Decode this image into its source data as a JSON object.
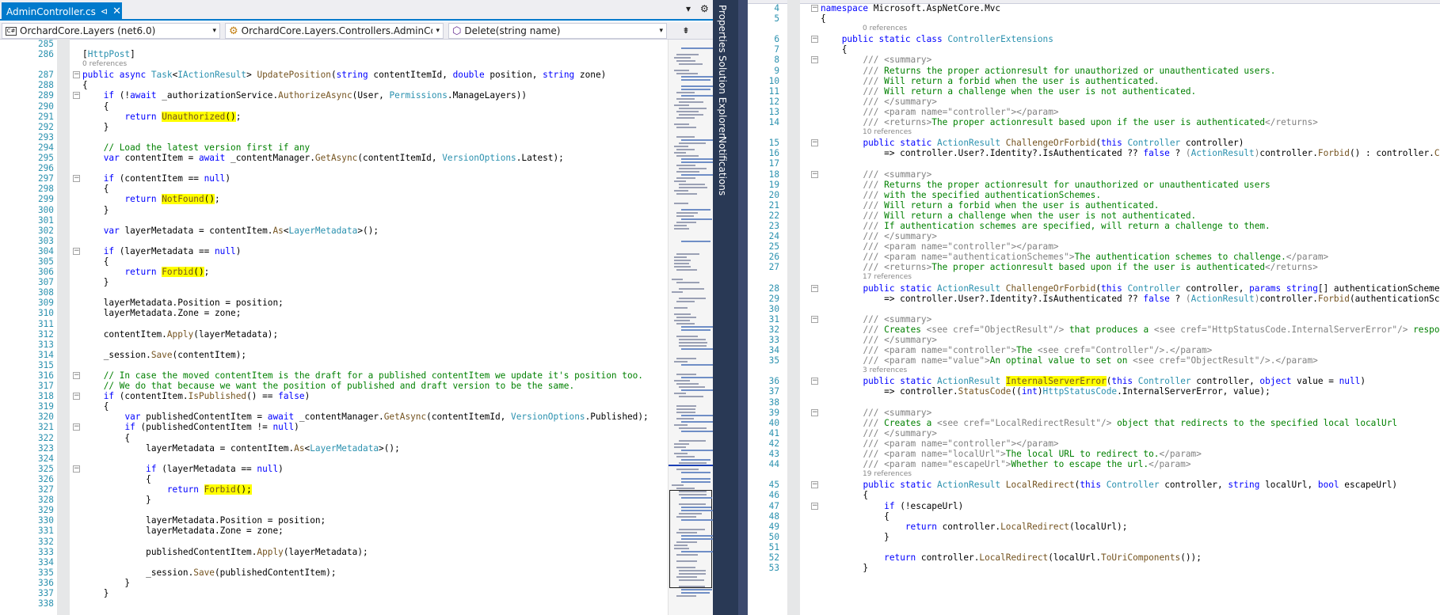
{
  "tab": {
    "title": "AdminController.cs",
    "pin": "⊲",
    "close": "✕"
  },
  "strip": {
    "dropdown": "▾",
    "settings": "⚙"
  },
  "nav": {
    "project": "OrchardCore.Layers (net6.0)",
    "project_glyph": "C#",
    "class": "OrchardCore.Layers.Controllers.AdminContro",
    "method": "Delete(string name)",
    "arrow": "▾",
    "split": "⇟"
  },
  "toolwindows": [
    "Properties",
    "Solution Explorer",
    "Notifications"
  ],
  "left_lines": [
    {
      "n": "285",
      "h": ""
    },
    {
      "n": "286",
      "h": "[<span class='t'>HttpPost</span>]"
    },
    {
      "ref": "0 references"
    },
    {
      "n": "287",
      "f": "−",
      "h": "<span class='k'>public async</span> <span class='t'>Task</span>&lt;<span class='t'>IActionResult</span>&gt; <span class='m'>UpdatePosition</span>(<span class='k'>string</span> contentItemId, <span class='k'>double</span> position, <span class='k'>string</span> zone)"
    },
    {
      "n": "288",
      "h": "{"
    },
    {
      "n": "289",
      "f": "−",
      "h": "    <span class='k'>if</span> (!<span class='k'>await</span> _authorizationService.<span class='m'>AuthorizeAsync</span>(User, <span class='t'>Permissions</span>.ManageLayers))"
    },
    {
      "n": "290",
      "h": "    {"
    },
    {
      "n": "291",
      "h": "        <span class='k'>return</span> <span class='hl'><span class='m'>Unauthorized</span>()</span>;"
    },
    {
      "n": "292",
      "h": "    }"
    },
    {
      "n": "293",
      "h": ""
    },
    {
      "n": "294",
      "h": "    <span class='c'>// Load the latest version first if any</span>"
    },
    {
      "n": "295",
      "h": "    <span class='k'>var</span> contentItem = <span class='k'>await</span> _contentManager.<span class='m'>GetAsync</span>(contentItemId, <span class='t'>VersionOptions</span>.Latest);"
    },
    {
      "n": "296",
      "h": ""
    },
    {
      "n": "297",
      "f": "−",
      "h": "    <span class='k'>if</span> (contentItem == <span class='k'>null</span>)"
    },
    {
      "n": "298",
      "h": "    {"
    },
    {
      "n": "299",
      "h": "        <span class='k'>return</span> <span class='hl'><span class='m'>NotFound</span>()</span>;"
    },
    {
      "n": "300",
      "h": "    }"
    },
    {
      "n": "301",
      "h": ""
    },
    {
      "n": "302",
      "h": "    <span class='k'>var</span> layerMetadata = contentItem.<span class='m'>As</span>&lt;<span class='t'>LayerMetadata</span>&gt;();"
    },
    {
      "n": "303",
      "h": ""
    },
    {
      "n": "304",
      "f": "−",
      "h": "    <span class='k'>if</span> (layerMetadata == <span class='k'>null</span>)"
    },
    {
      "n": "305",
      "h": "    {"
    },
    {
      "n": "306",
      "h": "        <span class='k'>return</span> <span class='hl'><span class='m'>Forbid</span>()</span>;"
    },
    {
      "n": "307",
      "h": "    }"
    },
    {
      "n": "308",
      "h": ""
    },
    {
      "n": "309",
      "h": "    layerMetadata.Position = position;"
    },
    {
      "n": "310",
      "h": "    layerMetadata.Zone = zone;"
    },
    {
      "n": "311",
      "h": ""
    },
    {
      "n": "312",
      "h": "    contentItem.<span class='m'>Apply</span>(layerMetadata);"
    },
    {
      "n": "313",
      "h": ""
    },
    {
      "n": "314",
      "h": "    _session.<span class='m'>Save</span>(contentItem);"
    },
    {
      "n": "315",
      "h": ""
    },
    {
      "n": "316",
      "f": "−",
      "h": "    <span class='c'>// In case the moved contentItem is the draft for a published contentItem we update it's position too.</span>"
    },
    {
      "n": "317",
      "h": "    <span class='c'>// We do that because we want the position of published and draft version to be the same.</span>"
    },
    {
      "n": "318",
      "f": "−",
      "h": "    <span class='k'>if</span> (contentItem.<span class='m'>IsPublished</span>() == <span class='k'>false</span>)"
    },
    {
      "n": "319",
      "h": "    {"
    },
    {
      "n": "320",
      "h": "        <span class='k'>var</span> publishedContentItem = <span class='k'>await</span> _contentManager.<span class='m'>GetAsync</span>(contentItemId, <span class='t'>VersionOptions</span>.Published);"
    },
    {
      "n": "321",
      "f": "−",
      "h": "        <span class='k'>if</span> (publishedContentItem != <span class='k'>null</span>)"
    },
    {
      "n": "322",
      "h": "        {"
    },
    {
      "n": "323",
      "h": "            layerMetadata = contentItem.<span class='m'>As</span>&lt;<span class='t'>LayerMetadata</span>&gt;();"
    },
    {
      "n": "324",
      "h": ""
    },
    {
      "n": "325",
      "f": "−",
      "h": "            <span class='k'>if</span> (layerMetadata == <span class='k'>null</span>)"
    },
    {
      "n": "326",
      "h": "            {"
    },
    {
      "n": "327",
      "h": "                <span class='k'>return</span> <span class='hl'><span class='m'>Forbid</span>();</span>"
    },
    {
      "n": "328",
      "h": "            }"
    },
    {
      "n": "329",
      "h": ""
    },
    {
      "n": "330",
      "h": "            layerMetadata.Position = position;"
    },
    {
      "n": "331",
      "h": "            layerMetadata.Zone = zone;"
    },
    {
      "n": "332",
      "h": ""
    },
    {
      "n": "333",
      "h": "            publishedContentItem.<span class='m'>Apply</span>(layerMetadata);"
    },
    {
      "n": "334",
      "h": ""
    },
    {
      "n": "335",
      "h": "            _session.<span class='m'>Save</span>(publishedContentItem);"
    },
    {
      "n": "336",
      "h": "        }"
    },
    {
      "n": "337",
      "h": "    }"
    },
    {
      "n": "338",
      "h": ""
    }
  ],
  "right_lines": [
    {
      "n": "4",
      "f": "−",
      "h": "<span class='k'>namespace</span> Microsoft.AspNetCore.Mvc"
    },
    {
      "n": "5",
      "h": "{"
    },
    {
      "ref": "0 references"
    },
    {
      "n": "6",
      "f": "−",
      "h": "    <span class='k'>public static class</span> <span class='t'>ControllerExtensions</span>"
    },
    {
      "n": "7",
      "h": "    {"
    },
    {
      "n": "8",
      "f": "−",
      "h": "        <span class='d'>/// &lt;summary&gt;</span>"
    },
    {
      "n": "9",
      "h": "        <span class='d'>///</span> <span class='c'>Returns the proper actionresult for unauthorized or unauthenticated users.</span>"
    },
    {
      "n": "10",
      "h": "        <span class='d'>///</span> <span class='c'>Will return a forbid when the user is authenticated.</span>"
    },
    {
      "n": "11",
      "h": "        <span class='d'>///</span> <span class='c'>Will return a challenge when the user is not authenticated.</span>"
    },
    {
      "n": "12",
      "h": "        <span class='d'>/// &lt;/summary&gt;</span>"
    },
    {
      "n": "13",
      "h": "        <span class='d'>/// &lt;param name=\"</span><span class='d'>controller</span><span class='d'>\"&gt;&lt;/param&gt;</span>"
    },
    {
      "n": "14",
      "h": "        <span class='d'>/// &lt;returns&gt;</span><span class='c'>The proper actionresult based upon if the user is authenticated</span><span class='d'>&lt;/returns&gt;</span>"
    },
    {
      "ref": "10 references"
    },
    {
      "n": "15",
      "f": "−",
      "h": "        <span class='k'>public static</span> <span class='t'>ActionResult</span> <span class='m'>ChallengeOrForbid</span>(<span class='k'>this</span> <span class='t'>Controller</span> controller)"
    },
    {
      "n": "16",
      "h": "            =&gt; controller.User?.Identity?.IsAuthenticated ?? <span class='k'>false</span> ? <span class='d'>(</span><span class='a'>ActionResult</span><span class='d'>)</span>controller.<span class='m'>Forbid</span>() : controller.<span class='m'>C</span>"
    },
    {
      "n": "17",
      "h": ""
    },
    {
      "n": "18",
      "f": "−",
      "h": "        <span class='d'>/// &lt;summary&gt;</span>"
    },
    {
      "n": "19",
      "h": "        <span class='d'>///</span> <span class='c'>Returns the proper actionresult for unauthorized or unauthenticated users</span>"
    },
    {
      "n": "20",
      "h": "        <span class='d'>///</span> <span class='c'>with the specified authenticationSchemes.</span>"
    },
    {
      "n": "21",
      "h": "        <span class='d'>///</span> <span class='c'>Will return a forbid when the user is authenticated.</span>"
    },
    {
      "n": "22",
      "h": "        <span class='d'>///</span> <span class='c'>Will return a challenge when the user is not authenticated.</span>"
    },
    {
      "n": "23",
      "h": "        <span class='d'>///</span> <span class='c'>If authentication schemes are specified, will return a challenge to them.</span>"
    },
    {
      "n": "24",
      "h": "        <span class='d'>/// &lt;/summary&gt;</span>"
    },
    {
      "n": "25",
      "h": "        <span class='d'>/// &lt;param name=\"controller\"&gt;&lt;/param&gt;</span>"
    },
    {
      "n": "26",
      "h": "        <span class='d'>/// &lt;param name=\"authenticationSchemes\"&gt;</span><span class='c'>The authentication schemes to challenge.</span><span class='d'>&lt;/param&gt;</span>"
    },
    {
      "n": "27",
      "h": "        <span class='d'>/// &lt;returns&gt;</span><span class='c'>The proper actionresult based upon if the user is authenticated</span><span class='d'>&lt;/returns&gt;</span>"
    },
    {
      "ref": "17 references"
    },
    {
      "n": "28",
      "f": "−",
      "h": "        <span class='k'>public static</span> <span class='t'>ActionResult</span> <span class='m'>ChallengeOrForbid</span>(<span class='k'>this</span> <span class='t'>Controller</span> controller, <span class='k'>params string</span>[] authenticationScheme"
    },
    {
      "n": "29",
      "h": "            =&gt; controller.User?.Identity?.IsAuthenticated ?? <span class='k'>false</span> ? <span class='d'>(</span><span class='a'>ActionResult</span><span class='d'>)</span>controller.<span class='m'>Forbid</span>(authenticationSc"
    },
    {
      "n": "30",
      "h": ""
    },
    {
      "n": "31",
      "f": "−",
      "h": "        <span class='d'>/// &lt;summary&gt;</span>"
    },
    {
      "n": "32",
      "h": "        <span class='d'>///</span> <span class='c'>Creates</span> <span class='d'>&lt;see cref=\"ObjectResult\"/&gt;</span> <span class='c'>that produces a</span> <span class='d'>&lt;see cref=\"HttpStatusCode.InternalServerError\"/&gt;</span> <span class='c'>respo</span>"
    },
    {
      "n": "33",
      "h": "        <span class='d'>/// &lt;/summary&gt;</span>"
    },
    {
      "n": "34",
      "h": "        <span class='d'>/// &lt;param name=\"controller\"&gt;</span><span class='c'>The</span> <span class='d'>&lt;see cref=\"Controller\"/&gt;.&lt;/param&gt;</span>"
    },
    {
      "n": "35",
      "h": "        <span class='d'>/// &lt;param name=\"value\"&gt;</span><span class='c'>An optinal value to set on</span> <span class='d'>&lt;see cref=\"ObjectResult\"/&gt;.&lt;/param&gt;</span>"
    },
    {
      "ref": "3 references"
    },
    {
      "n": "36",
      "f": "−",
      "h": "        <span class='k'>public static</span> <span class='t'>ActionResult</span> <span class='hl'><span class='m'>InternalServerError</span></span>(<span class='k'>this</span> <span class='t'>Controller</span> controller, <span class='k'>object</span> value = <span class='k'>null</span>)"
    },
    {
      "n": "37",
      "h": "            =&gt; controller.<span class='m'>StatusCode</span>((<span class='k'>int</span>)<span class='t'>HttpStatusCode</span>.InternalServerError, value);"
    },
    {
      "n": "38",
      "h": ""
    },
    {
      "n": "39",
      "f": "−",
      "h": "        <span class='d'>/// &lt;summary&gt;</span>"
    },
    {
      "n": "40",
      "h": "        <span class='d'>///</span> <span class='c'>Creates a</span> <span class='d'>&lt;see cref=\"LocalRedirectResult\"/&gt;</span> <span class='c'>object that redirects to the specified local localUrl</span>"
    },
    {
      "n": "41",
      "h": "        <span class='d'>/// &lt;/summary&gt;</span>"
    },
    {
      "n": "42",
      "h": "        <span class='d'>/// &lt;param name=\"controller\"&gt;&lt;/param&gt;</span>"
    },
    {
      "n": "43",
      "h": "        <span class='d'>/// &lt;param name=\"localUrl\"&gt;</span><span class='c'>The local URL to redirect to.</span><span class='d'>&lt;/param&gt;</span>"
    },
    {
      "n": "44",
      "h": "        <span class='d'>/// &lt;param name=\"escapeUrl\"&gt;</span><span class='c'>Whether to escape the url.</span><span class='d'>&lt;/param&gt;</span>"
    },
    {
      "ref": "19 references"
    },
    {
      "n": "45",
      "f": "−",
      "h": "        <span class='k'>public static</span> <span class='t'>ActionResult</span> <span class='m'>LocalRedirect</span>(<span class='k'>this</span> <span class='t'>Controller</span> controller, <span class='k'>string</span> localUrl, <span class='k'>bool</span> escapeUrl)"
    },
    {
      "n": "46",
      "h": "        {"
    },
    {
      "n": "47",
      "f": "−",
      "h": "            <span class='k'>if</span> (!escapeUrl)"
    },
    {
      "n": "48",
      "h": "            {"
    },
    {
      "n": "49",
      "h": "                <span class='k'>return</span> controller.<span class='m'>LocalRedirect</span>(localUrl);"
    },
    {
      "n": "50",
      "h": "            }"
    },
    {
      "n": "51",
      "h": ""
    },
    {
      "n": "52",
      "h": "            <span class='k'>return</span> controller.<span class='m'>LocalRedirect</span>(localUrl.<span class='m'>ToUriComponents</span>());"
    },
    {
      "n": "53",
      "h": "        }"
    }
  ]
}
